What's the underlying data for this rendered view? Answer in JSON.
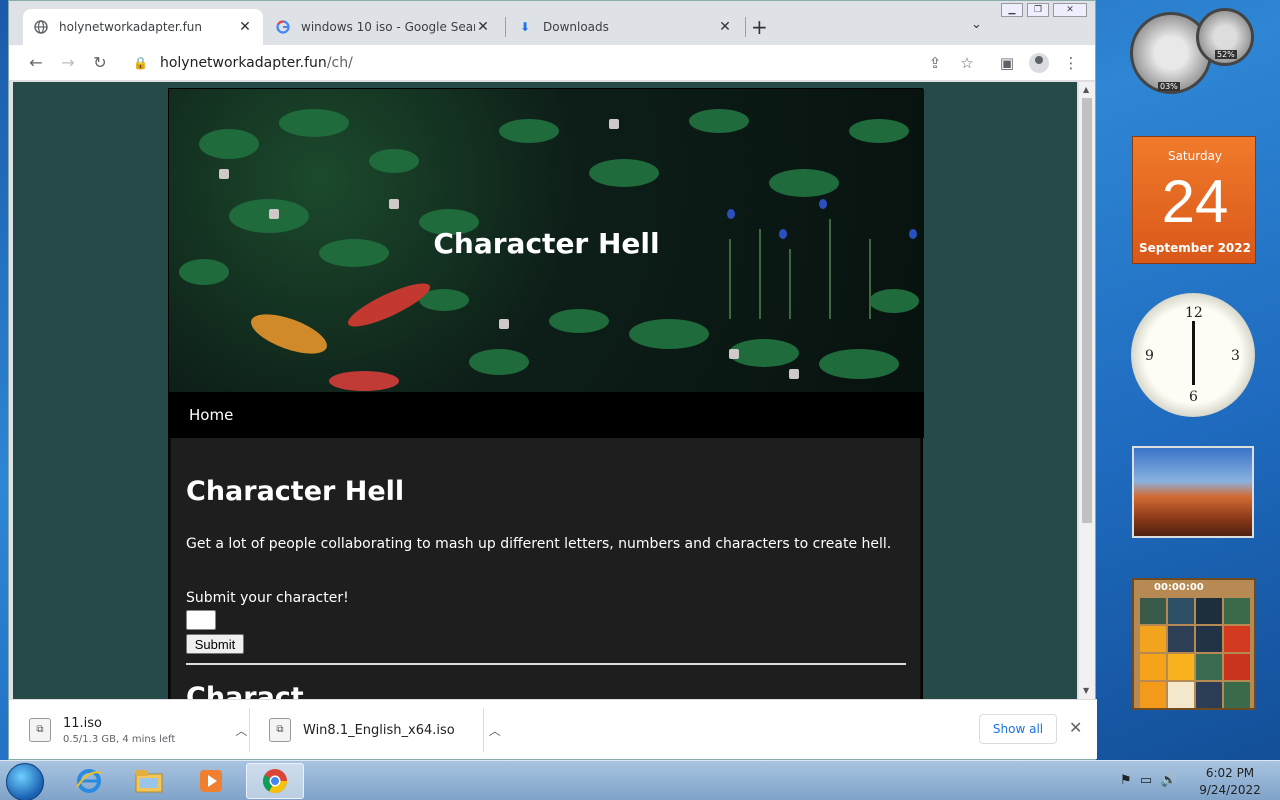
{
  "browser": {
    "tabs": [
      {
        "title": "holynetworkadapter.fun",
        "icon": "globe-icon",
        "active": true
      },
      {
        "title": "windows 10 iso - Google Search",
        "icon": "google-icon",
        "active": false
      },
      {
        "title": "Downloads",
        "icon": "download-icon",
        "active": false
      }
    ],
    "url_host": "holynetworkadapter.fun",
    "url_path": "/ch/"
  },
  "site": {
    "hero_title": "Character Hell",
    "nav_home": "Home",
    "heading": "Character Hell",
    "description": "Get a lot of people collaborating to mash up different letters, numbers and characters to create hell.",
    "submit_label": "Submit your character!",
    "submit_button": "Submit",
    "next_heading": "Charact"
  },
  "downloads": {
    "items": [
      {
        "name": "11.iso",
        "status": "0.5/1.3 GB, 4 mins left"
      },
      {
        "name": "Win8.1_English_x64.iso",
        "status": ""
      }
    ],
    "show_all": "Show all"
  },
  "gadgets": {
    "cpu_value": "03%",
    "mem_value": "52%",
    "calendar_day": "Saturday",
    "calendar_date": "24",
    "calendar_month": "September 2022",
    "puzzle_time": "00:00:00"
  },
  "taskbar": {
    "time": "6:02 PM",
    "date": "9/24/2022"
  },
  "colors": {
    "page_bg": "#264a47",
    "content_bg": "#1e1e1e",
    "calendar_orange": "#e8692a"
  }
}
